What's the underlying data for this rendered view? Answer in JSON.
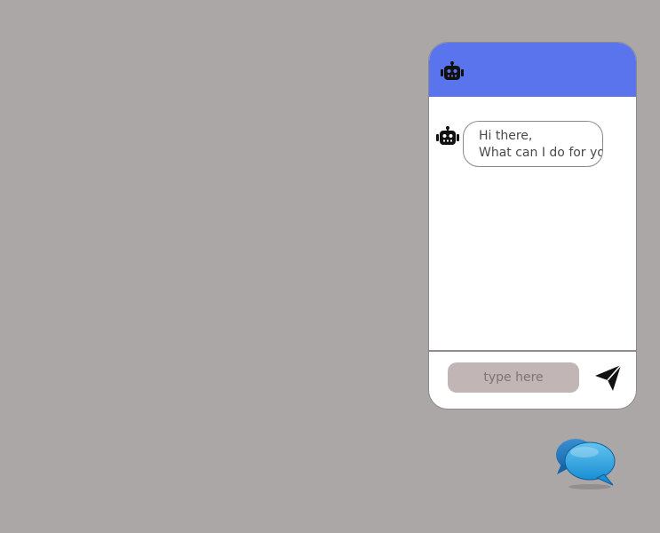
{
  "header": {
    "icon": "robot-icon"
  },
  "messages": [
    {
      "sender": "bot",
      "icon": "robot-icon",
      "lines": [
        "Hi there,",
        "What can I do for you"
      ]
    }
  ],
  "input": {
    "placeholder": "type here",
    "value": ""
  },
  "send": {
    "icon": "paper-plane-icon"
  },
  "launcher": {
    "icon": "chat-bubbles-icon"
  },
  "colors": {
    "background": "#aba7a7",
    "header": "#5974ec",
    "window": "#ffffff",
    "input_bg": "#c1b5b5",
    "launcher_blue": "#1e8fd6"
  }
}
